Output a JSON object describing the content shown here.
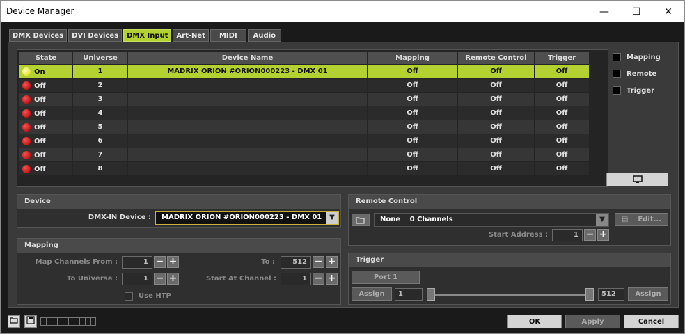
{
  "window": {
    "title": "Device Manager",
    "minimize": "—",
    "maximize": "☐",
    "close": "✕"
  },
  "tabs": [
    "DMX Devices",
    "DVI Devices",
    "DMX Input",
    "Art-Net",
    "MIDI",
    "Audio"
  ],
  "active_tab": "DMX Input",
  "grid": {
    "columns": [
      "State",
      "Universe",
      "Device Name",
      "Mapping",
      "Remote Control",
      "Trigger"
    ],
    "rows": [
      {
        "state": "On",
        "universe": "1",
        "device": "MADRIX ORION #ORION000223 - DMX 01",
        "mapping": "Off",
        "remote": "Off",
        "trigger": "Off"
      },
      {
        "state": "Off",
        "universe": "2",
        "device": "",
        "mapping": "Off",
        "remote": "Off",
        "trigger": "Off"
      },
      {
        "state": "Off",
        "universe": "3",
        "device": "",
        "mapping": "Off",
        "remote": "Off",
        "trigger": "Off"
      },
      {
        "state": "Off",
        "universe": "4",
        "device": "",
        "mapping": "Off",
        "remote": "Off",
        "trigger": "Off"
      },
      {
        "state": "Off",
        "universe": "5",
        "device": "",
        "mapping": "Off",
        "remote": "Off",
        "trigger": "Off"
      },
      {
        "state": "Off",
        "universe": "6",
        "device": "",
        "mapping": "Off",
        "remote": "Off",
        "trigger": "Off"
      },
      {
        "state": "Off",
        "universe": "7",
        "device": "",
        "mapping": "Off",
        "remote": "Off",
        "trigger": "Off"
      },
      {
        "state": "Off",
        "universe": "8",
        "device": "",
        "mapping": "Off",
        "remote": "Off",
        "trigger": "Off"
      }
    ]
  },
  "filters": {
    "mapping": "Mapping",
    "remote": "Remote",
    "trigger": "Trigger"
  },
  "device": {
    "title": "Device",
    "label": "DMX-IN Device :",
    "value": "MADRIX ORION #ORION000223 - DMX 01"
  },
  "mapping": {
    "title": "Mapping",
    "from_label": "Map Channels From :",
    "from_value": "1",
    "to_label": "To :",
    "to_value": "512",
    "universe_label": "To Universe :",
    "universe_value": "1",
    "start_label": "Start At Channel :",
    "start_value": "1",
    "htp_label": "Use HTP"
  },
  "remote": {
    "title": "Remote Control",
    "none": "None",
    "channels": "0 Channels",
    "edit": "Edit...",
    "start_label": "Start Address :",
    "start_value": "1"
  },
  "trigger": {
    "title": "Trigger",
    "port": "Port 1",
    "assign": "Assign",
    "min_value": "1",
    "max_value": "512"
  },
  "buttons": {
    "ok": "OK",
    "apply": "Apply",
    "cancel": "Cancel"
  },
  "colors": {
    "accent": "#b3d232",
    "led_on": "#ffff80",
    "led_off": "#d00000"
  }
}
